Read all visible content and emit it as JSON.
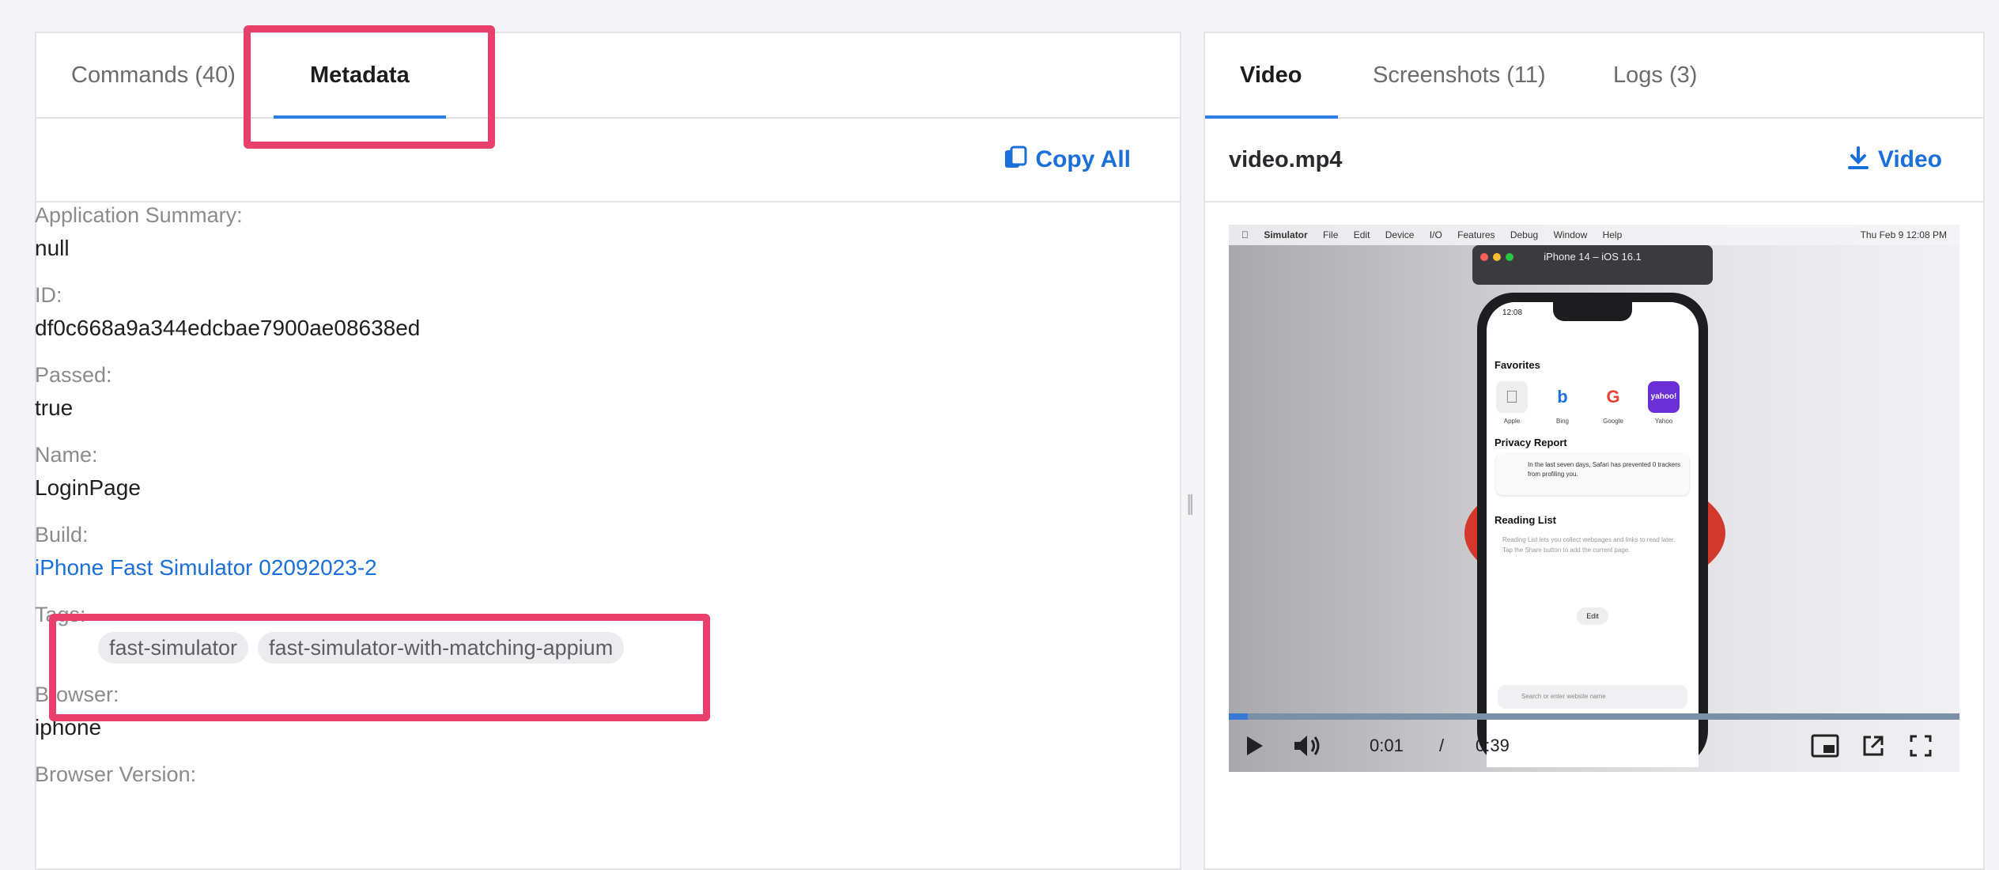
{
  "left_tabs": [
    {
      "label": "Commands (40)"
    },
    {
      "label": "Metadata"
    }
  ],
  "copy_all_label": "Copy All",
  "metadata": [
    {
      "label": "Application Summary:",
      "value": "null"
    },
    {
      "label": "ID:",
      "value": "df0c668a9a344edcbae7900ae08638ed"
    },
    {
      "label": "Passed:",
      "value": "true"
    },
    {
      "label": "Name:",
      "value": "LoginPage"
    },
    {
      "label": "Build:",
      "value": "iPhone Fast Simulator 02092023-2"
    },
    {
      "label": "Tags:"
    },
    {
      "label": "Browser:",
      "value": "iphone"
    },
    {
      "label": "Browser Version:"
    }
  ],
  "tags": [
    "fast-simulator",
    "fast-simulator-with-matching-appium"
  ],
  "right_tabs": [
    {
      "label": "Video"
    },
    {
      "label": "Screenshots (11)"
    },
    {
      "label": "Logs (3)"
    }
  ],
  "video": {
    "filename": "video.mp4",
    "download_label": "Video",
    "current_time": "0:01",
    "separator": "/",
    "duration": "0:39",
    "progress_fraction": 0.026
  },
  "simulator": {
    "menu_app": "Simulator",
    "menu_items": [
      "File",
      "Edit",
      "Device",
      "I/O",
      "Features",
      "Debug",
      "Window",
      "Help"
    ],
    "clock": "Thu Feb 9 12:08 PM",
    "window_title": "iPhone 14 – iOS 16.1",
    "phone_time": "12:08",
    "favorites_heading": "Favorites",
    "favorites": [
      "Apple",
      "Bing",
      "Google",
      "Yahoo"
    ],
    "privacy_heading": "Privacy Report",
    "privacy_text": "In the last seven days, Safari has prevented 0 trackers from profiling you.",
    "reading_heading": "Reading List",
    "reading_text": "Reading List lets you collect webpages and links to read later. Tap the Share button to add the current page.",
    "edit_label": "Edit",
    "search_placeholder": "Search or enter website name"
  },
  "colors": {
    "accent": "#2f7de1",
    "highlight": "#e8406b",
    "link": "#1b6fd8"
  }
}
